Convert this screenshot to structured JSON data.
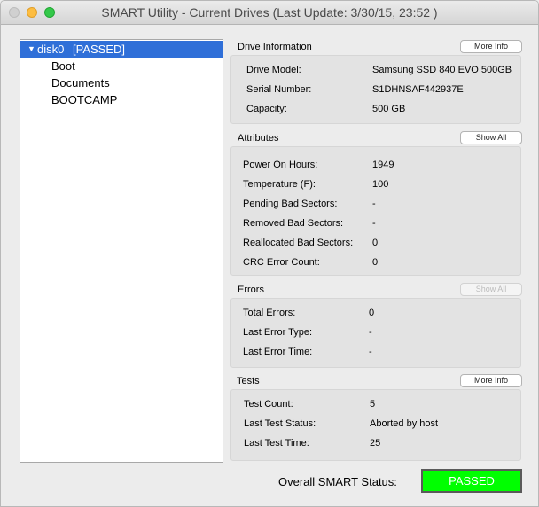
{
  "window": {
    "title": "SMART Utility - Current Drives (Last Update: 3/30/15, 23:52 )"
  },
  "sidebar": {
    "disk": {
      "arrow": "▼",
      "label": "disk0",
      "status": "[PASSED]"
    },
    "volumes": [
      "Boot",
      "Documents",
      "BOOTCAMP"
    ]
  },
  "drive_info": {
    "title": "Drive Information",
    "button": "More Info",
    "rows": [
      {
        "label": "Drive Model:",
        "value": "Samsung SSD 840 EVO 500GB"
      },
      {
        "label": "Serial Number:",
        "value": "S1DHNSAF442937E"
      },
      {
        "label": "Capacity:",
        "value": "500 GB"
      }
    ]
  },
  "attributes": {
    "title": "Attributes",
    "button": "Show All",
    "rows": [
      {
        "label": "Power On Hours:",
        "value": "1949"
      },
      {
        "label": "Temperature (F):",
        "value": "100"
      },
      {
        "label": "Pending Bad Sectors:",
        "value": "-"
      },
      {
        "label": "Removed Bad Sectors:",
        "value": "-"
      },
      {
        "label": "Reallocated Bad Sectors:",
        "value": "0"
      },
      {
        "label": "CRC Error Count:",
        "value": "0"
      }
    ]
  },
  "errors": {
    "title": "Errors",
    "button": "Show All",
    "rows": [
      {
        "label": "Total Errors:",
        "value": "0"
      },
      {
        "label": "Last Error Type:",
        "value": "-"
      },
      {
        "label": "Last Error Time:",
        "value": "-"
      }
    ]
  },
  "tests": {
    "title": "Tests",
    "button": "More Info",
    "rows": [
      {
        "label": "Test Count:",
        "value": "5"
      },
      {
        "label": "Last Test Status:",
        "value": "Aborted by host"
      },
      {
        "label": "Last Test Time:",
        "value": "25"
      }
    ]
  },
  "overall": {
    "label": "Overall SMART Status:",
    "status": "PASSED",
    "status_color": "#00ff00"
  }
}
